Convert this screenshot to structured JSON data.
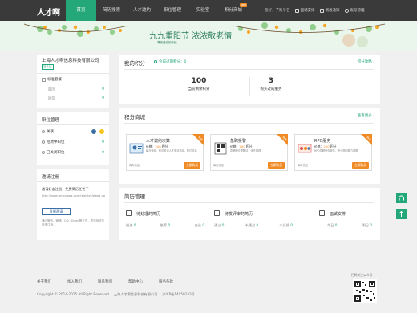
{
  "header": {
    "logo": "人才啊",
    "nav": [
      {
        "label": "首页",
        "active": true
      },
      {
        "label": "简历搜索",
        "active": false
      },
      {
        "label": "人才邀约",
        "active": false
      },
      {
        "label": "职位管理",
        "active": false
      },
      {
        "label": "实验室",
        "active": false
      },
      {
        "label": "积分商城",
        "active": false,
        "badge": "new"
      }
    ],
    "greeting": "您好，",
    "user_label": "子账号名",
    "interview_notice": "面试安排",
    "message_notice": "消息通知",
    "account_manage": "账号管理"
  },
  "banner": {
    "title": "九九重阳节  浓浓敬老情",
    "subtitle": "尊老爱幼的传统"
  },
  "company": {
    "name": "上海人才啊信息科技有限公司",
    "verified_badge": "已认证",
    "member_type": "标准套餐",
    "stats": [
      {
        "label": "简历",
        "value": "0"
      },
      {
        "label": "短信",
        "value": "0"
      }
    ]
  },
  "jobs_panel": {
    "title": "职位管理",
    "items": [
      {
        "label": "关联",
        "count": "0"
      },
      {
        "label": "招聘中职位",
        "count": "0"
      },
      {
        "label": "已关闭职位",
        "count": "0"
      }
    ]
  },
  "invite_panel": {
    "title": "邀请注册",
    "desc": "邀请好友注册，免费简历任性下",
    "link": "http://www.rencaiaaa.com/register/step1.do",
    "button": "复制邀请",
    "note": "通过微信、微博、QQ、Email等方式，发送给好友邀请注册。"
  },
  "points": {
    "title": "我的积分",
    "today": "今日过期积分：0",
    "strategy": "积分攻略",
    "remaining_value": "100",
    "remaining_label": "当前剩余积分",
    "purchased_value": "3",
    "purchased_label": "购买过的服务"
  },
  "mall": {
    "title": "积分商城",
    "more": "查看更多",
    "items": [
      {
        "name": "人才邀约次数",
        "price_label": "价格：",
        "price": "200",
        "unit": "积分",
        "desc": "每次使用，即可发送人才邀请消息，职位信息",
        "stock": "库存充足",
        "button": "立即购买",
        "hot": "热卖"
      },
      {
        "name": "急聘投警",
        "price_label": "价格：",
        "price": "200",
        "unit": "积分",
        "desc": "急聘职位更醒目，优先推荐",
        "stock": "库存充足",
        "button": "立即购买",
        "hot": "热卖"
      },
      {
        "name": "RPO服务",
        "price_label": "价格：",
        "price": "200",
        "unit": "积分",
        "desc": "RPO招聘外包服务，专业顾问助力招聘",
        "stock": "库存充足",
        "button": "立即购买",
        "hot": "热卖"
      }
    ]
  },
  "resume": {
    "title": "简历管理",
    "groups": [
      {
        "title": "待处理的简历",
        "cells": [
          {
            "label": "投递",
            "value": "0"
          },
          {
            "label": "推荐",
            "value": "0"
          },
          {
            "label": "自选",
            "value": "0"
          }
        ]
      },
      {
        "title": "待发评审的简历",
        "cells": [
          {
            "label": "通过",
            "value": "0"
          },
          {
            "label": "未通过",
            "value": "0"
          },
          {
            "label": "未反馈",
            "value": "0"
          }
        ]
      },
      {
        "title": "面试安排",
        "cells": [
          {
            "label": "今日",
            "value": "0"
          },
          {
            "label": "明日",
            "value": "0"
          }
        ]
      }
    ]
  },
  "footer": {
    "links": [
      "关于我们",
      "加入我们",
      "联系我们",
      "帮助中心",
      "服务条款"
    ],
    "copyright": "Copyright © 2014-2015 All Right Reserved",
    "company": "上海人才啊信息科技有限公司",
    "icp": "沪ICP备14050243号",
    "qr_caption": "扫码关注公众号"
  },
  "colors": {
    "brand": "#24a87a",
    "accent": "#f08a24",
    "topbar": "#3a3a3a"
  }
}
